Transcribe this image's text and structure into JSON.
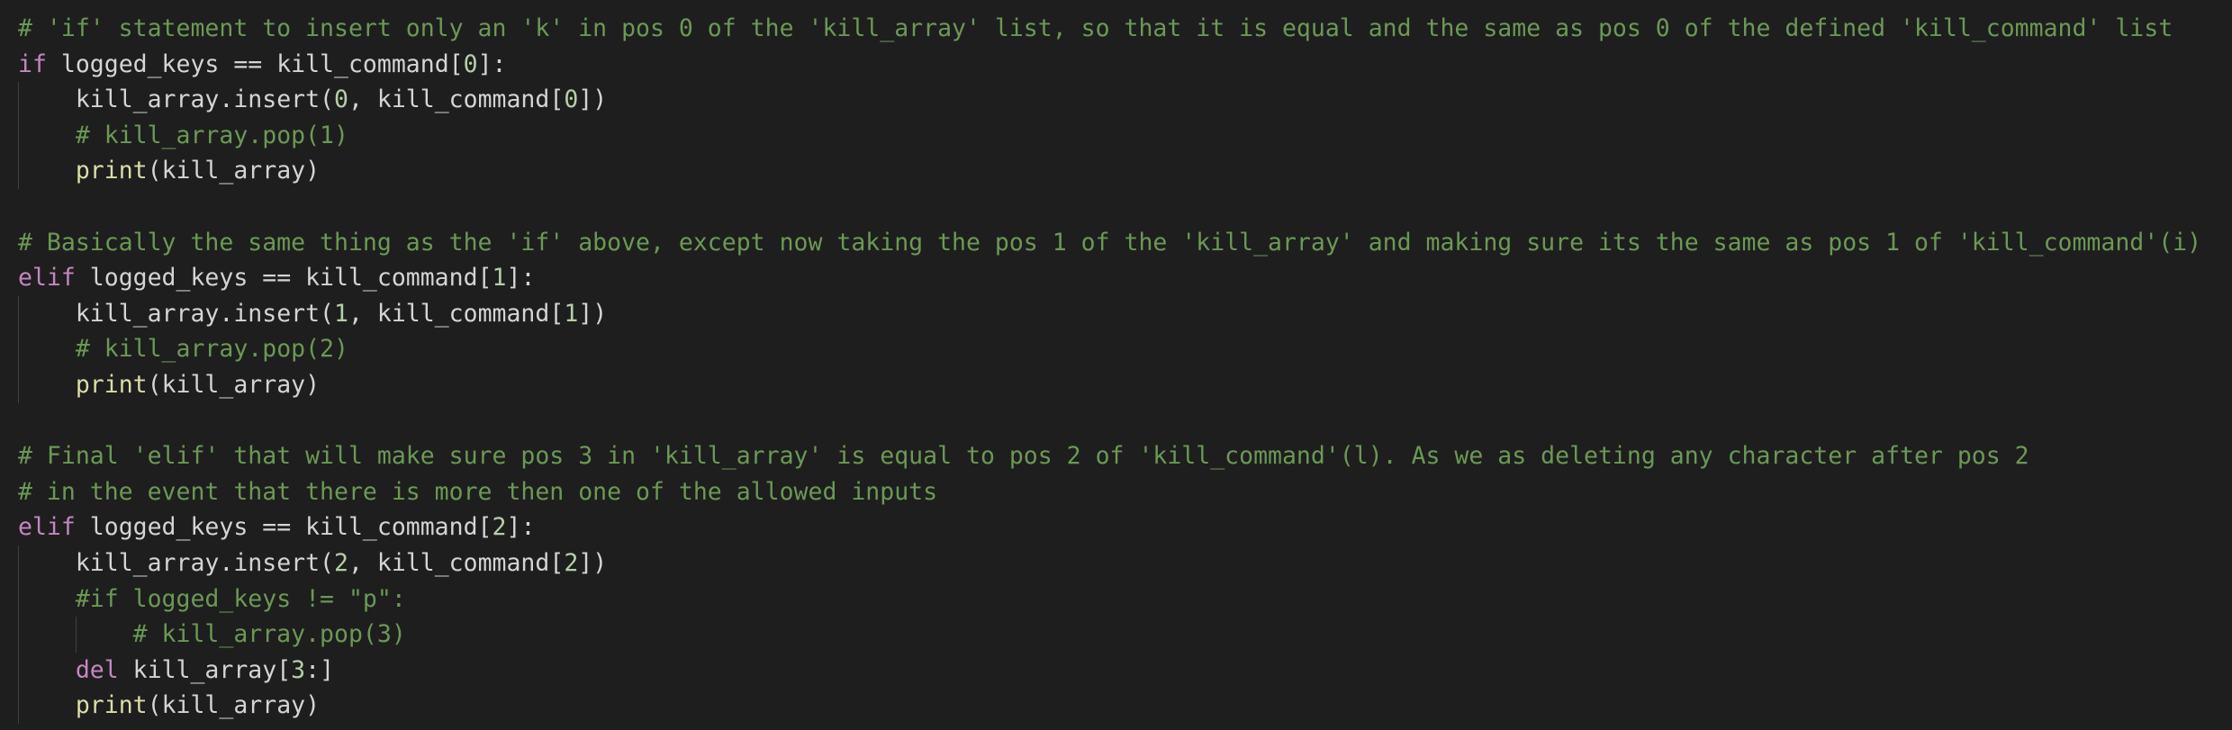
{
  "editor": {
    "colors": {
      "background": "#1e1e1e",
      "comment": "#6a9955",
      "keyword": "#c586c0",
      "function": "#dcdcaa",
      "number": "#b5cea8",
      "string": "#ce9178",
      "plain": "#d4d4d4"
    },
    "lines": [
      {
        "indent": 0,
        "tokens": [
          {
            "t": "comment",
            "v": "# 'if' statement to insert only an 'k' in pos 0 of the 'kill_array' list, so that it is equal and the same as pos 0 of the defined 'kill_command' list"
          }
        ]
      },
      {
        "indent": 0,
        "tokens": [
          {
            "t": "keyword",
            "v": "if"
          },
          {
            "t": "plain",
            "v": " logged_keys == kill_command["
          },
          {
            "t": "number",
            "v": "0"
          },
          {
            "t": "plain",
            "v": "]:"
          }
        ]
      },
      {
        "indent": 1,
        "tokens": [
          {
            "t": "plain",
            "v": "kill_array.insert("
          },
          {
            "t": "number",
            "v": "0"
          },
          {
            "t": "plain",
            "v": ", kill_command["
          },
          {
            "t": "number",
            "v": "0"
          },
          {
            "t": "plain",
            "v": "])"
          }
        ]
      },
      {
        "indent": 1,
        "tokens": [
          {
            "t": "comment",
            "v": "# kill_array.pop(1)"
          }
        ]
      },
      {
        "indent": 1,
        "tokens": [
          {
            "t": "func",
            "v": "print"
          },
          {
            "t": "plain",
            "v": "(kill_array)"
          }
        ]
      },
      {
        "indent": 0,
        "tokens": []
      },
      {
        "indent": 0,
        "tokens": [
          {
            "t": "comment",
            "v": "# Basically the same thing as the 'if' above, except now taking the pos 1 of the 'kill_array' and making sure its the same as pos 1 of 'kill_command'(i)"
          }
        ]
      },
      {
        "indent": 0,
        "tokens": [
          {
            "t": "keyword",
            "v": "elif"
          },
          {
            "t": "plain",
            "v": " logged_keys == kill_command["
          },
          {
            "t": "number",
            "v": "1"
          },
          {
            "t": "plain",
            "v": "]:"
          }
        ]
      },
      {
        "indent": 1,
        "tokens": [
          {
            "t": "plain",
            "v": "kill_array.insert("
          },
          {
            "t": "number",
            "v": "1"
          },
          {
            "t": "plain",
            "v": ", kill_command["
          },
          {
            "t": "number",
            "v": "1"
          },
          {
            "t": "plain",
            "v": "])"
          }
        ]
      },
      {
        "indent": 1,
        "tokens": [
          {
            "t": "comment",
            "v": "# kill_array.pop(2)"
          }
        ]
      },
      {
        "indent": 1,
        "tokens": [
          {
            "t": "func",
            "v": "print"
          },
          {
            "t": "plain",
            "v": "(kill_array)"
          }
        ]
      },
      {
        "indent": 0,
        "tokens": []
      },
      {
        "indent": 0,
        "tokens": [
          {
            "t": "comment",
            "v": "# Final 'elif' that will make sure pos 3 in 'kill_array' is equal to pos 2 of 'kill_command'(l). As we as deleting any character after pos 2"
          }
        ]
      },
      {
        "indent": 0,
        "tokens": [
          {
            "t": "comment",
            "v": "# in the event that there is more then one of the allowed inputs"
          }
        ]
      },
      {
        "indent": 0,
        "tokens": [
          {
            "t": "keyword",
            "v": "elif"
          },
          {
            "t": "plain",
            "v": " logged_keys == kill_command["
          },
          {
            "t": "number",
            "v": "2"
          },
          {
            "t": "plain",
            "v": "]:"
          }
        ]
      },
      {
        "indent": 1,
        "tokens": [
          {
            "t": "plain",
            "v": "kill_array.insert("
          },
          {
            "t": "number",
            "v": "2"
          },
          {
            "t": "plain",
            "v": ", kill_command["
          },
          {
            "t": "number",
            "v": "2"
          },
          {
            "t": "plain",
            "v": "])"
          }
        ]
      },
      {
        "indent": 1,
        "tokens": [
          {
            "t": "comment",
            "v": "#if logged_keys != \"p\":"
          }
        ]
      },
      {
        "indent": 2,
        "tokens": [
          {
            "t": "comment",
            "v": "# kill_array.pop(3)"
          }
        ]
      },
      {
        "indent": 1,
        "tokens": [
          {
            "t": "keyword",
            "v": "del"
          },
          {
            "t": "plain",
            "v": " kill_array["
          },
          {
            "t": "number",
            "v": "3"
          },
          {
            "t": "plain",
            "v": ":]"
          }
        ]
      },
      {
        "indent": 1,
        "tokens": [
          {
            "t": "func",
            "v": "print"
          },
          {
            "t": "plain",
            "v": "(kill_array)"
          }
        ]
      }
    ]
  }
}
